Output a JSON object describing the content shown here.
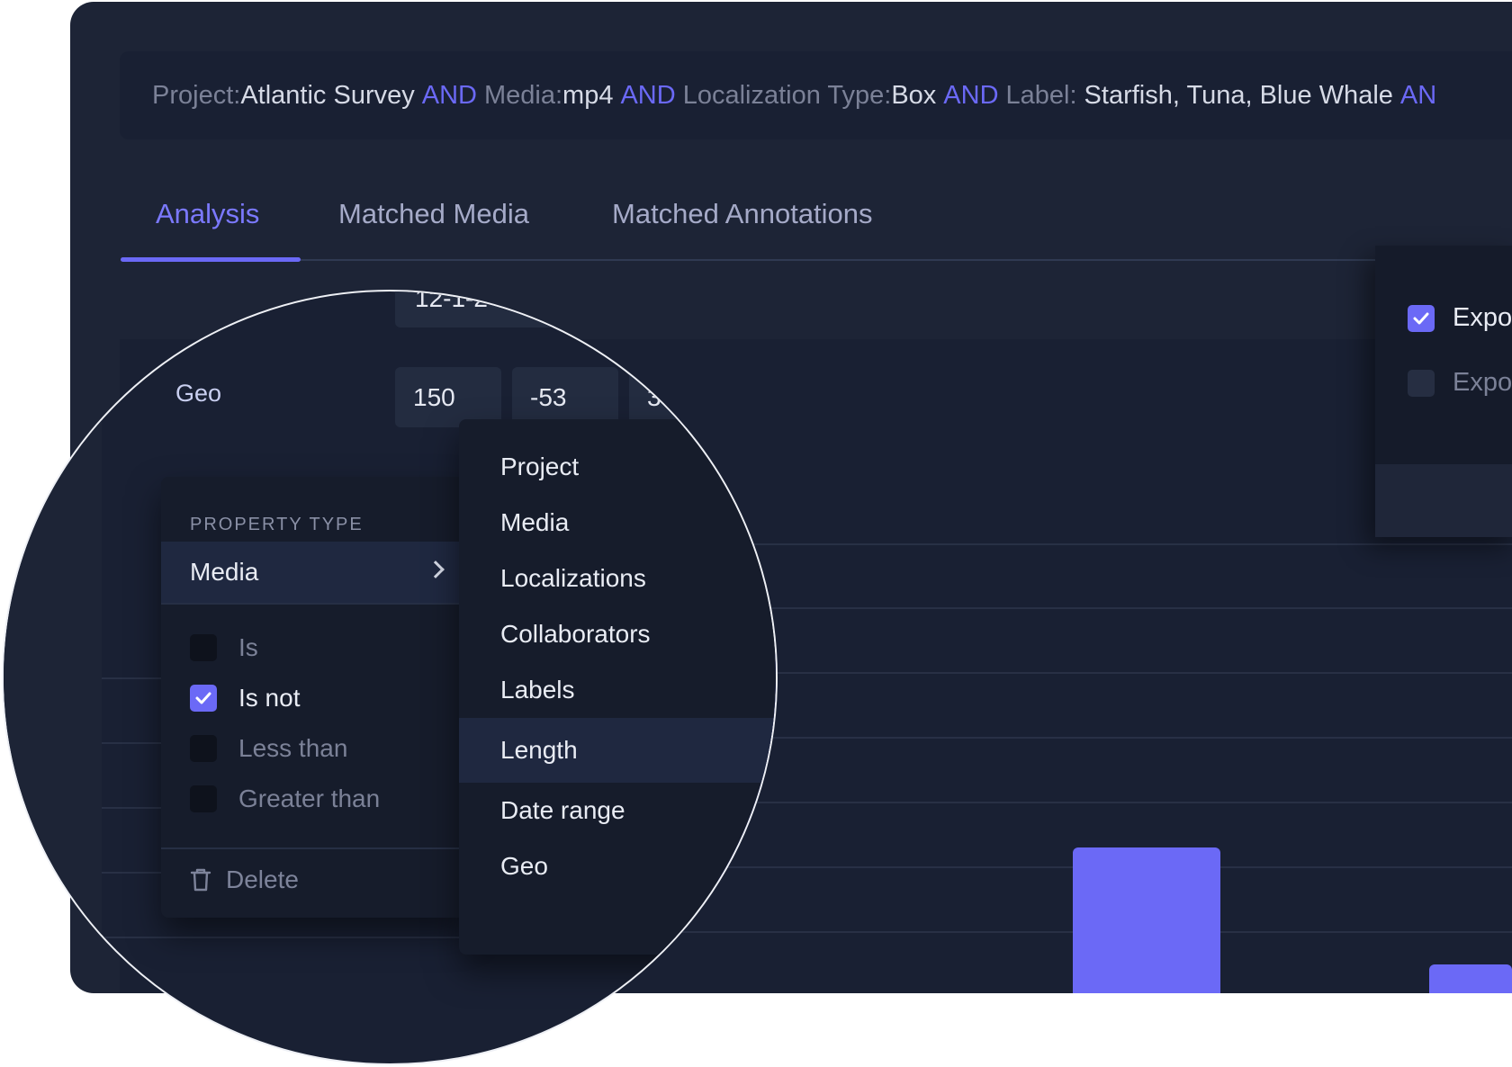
{
  "query": {
    "project_key": "Project:",
    "project_value": "Atlantic Survey",
    "and_1": "AND",
    "media_key": "Media:",
    "media_value": "mp4",
    "and_2": "AND",
    "loc_key": "Localization Type:",
    "loc_value": "Box",
    "and_3": "AND",
    "label_key": "Label:",
    "label_value": "Starfish, Tuna, Blue Whale",
    "and_4": "AN"
  },
  "tabs": [
    {
      "label": "Analysis",
      "active": true
    },
    {
      "label": "Matched Media",
      "active": false
    },
    {
      "label": "Matched Annotations",
      "active": false
    }
  ],
  "export_panel": {
    "option_1": {
      "label": "Expo",
      "checked": true
    },
    "option_2": {
      "label": "Expo",
      "checked": false
    }
  },
  "filters": {
    "date_value": "12-1-2",
    "geo_label": "Geo",
    "geo_values": [
      "150",
      "-53",
      "3"
    ]
  },
  "property_menu": {
    "title": "PROPERTY TYPE",
    "selected": "Media",
    "conditions": [
      {
        "label": "Is",
        "checked": false
      },
      {
        "label": "Is not",
        "checked": true
      },
      {
        "label": "Less than",
        "checked": false
      },
      {
        "label": "Greater than",
        "checked": false
      }
    ],
    "delete_label": "Delete"
  },
  "field_menu": {
    "items": [
      "Project",
      "Media",
      "Localizations",
      "Collaborators",
      "Labels",
      "Length",
      "Date range",
      "Geo"
    ],
    "highlighted": "Length"
  },
  "colors": {
    "background": "#1d2436",
    "panel": "#192033",
    "accent": "#6b69f6",
    "text_primary": "#e9ecf4",
    "text_muted": "#7b8197"
  }
}
